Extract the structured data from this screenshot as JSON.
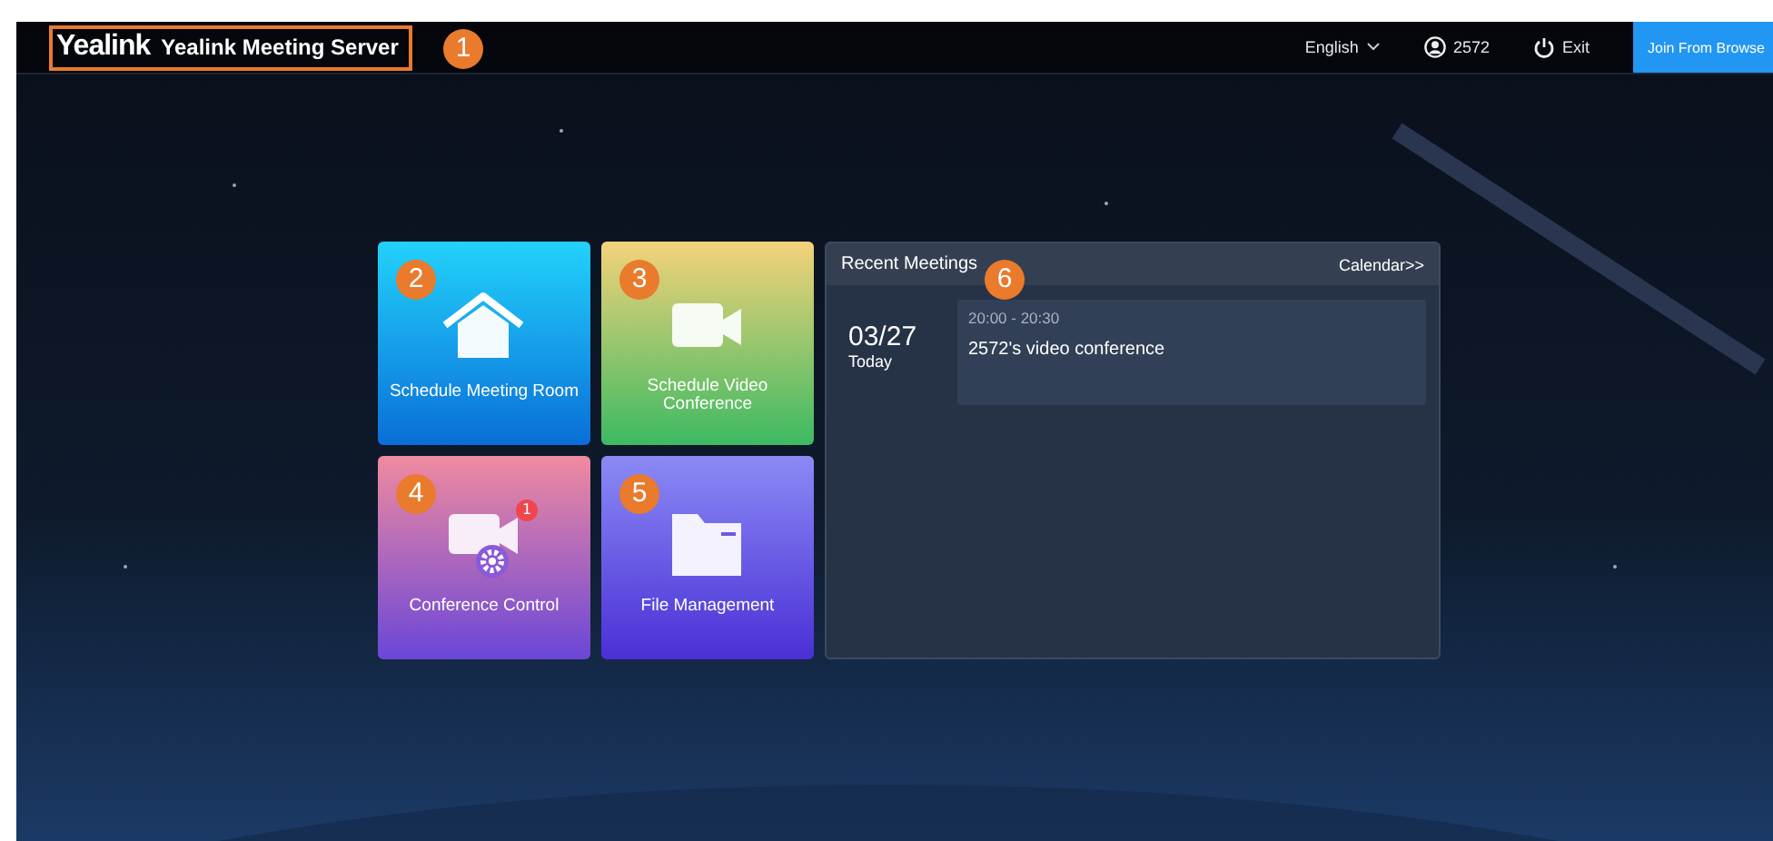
{
  "header": {
    "logo": "Yealink",
    "product": "Yealink Meeting Server",
    "callout": "1",
    "language": "English",
    "user": "2572",
    "exit": "Exit",
    "join_button": "Join From Browse"
  },
  "tiles": [
    {
      "kind": "home",
      "label": "Schedule Meeting Room",
      "callout": "2"
    },
    {
      "kind": "video",
      "label": "Schedule Video Conference",
      "callout": "3"
    },
    {
      "kind": "control",
      "label": "Conference Control",
      "callout": "4",
      "badge": "1"
    },
    {
      "kind": "folder",
      "label": "File Management",
      "callout": "5"
    }
  ],
  "recent_meetings": {
    "title": "Recent Meetings",
    "callout": "6",
    "calendar_link": "Calendar>>",
    "days": [
      {
        "date": "03/27",
        "label": "Today",
        "meetings": [
          {
            "time": "20:00 - 20:30",
            "title": "2572's video conference"
          }
        ]
      }
    ]
  }
}
